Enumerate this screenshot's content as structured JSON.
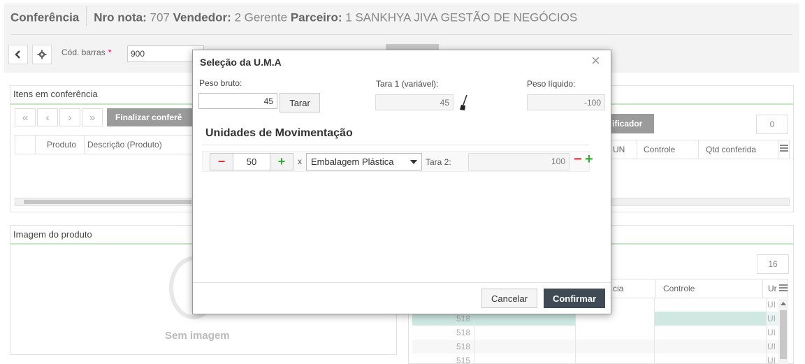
{
  "header": {
    "title": "Conferência",
    "nro_nota_label": "Nro nota:",
    "nro_nota_value": "707",
    "vendedor_label": "Vendedor:",
    "vendedor_value": "2 Gerente",
    "parceiro_label": "Parceiro:",
    "parceiro_value": "1 SANKHYA JIVA GESTÃO DE NEGÓCIOS"
  },
  "toolbar": {
    "back_icon": "chevron-left",
    "settings_icon": "gear",
    "cod_barras_label": "Cód. barras",
    "required_mark": "*",
    "cod_barras_value": "900"
  },
  "itens_panel": {
    "title": "Itens em conferência",
    "finalizar_label": "Finalizar conferê",
    "columns": [
      "Produto",
      "Descrição (Produto)"
    ]
  },
  "right_panel_top": {
    "verificador_label": "ificador",
    "count": "0",
    "columns": [
      "UN",
      "Controle",
      "Qtd conferida"
    ]
  },
  "imagem_panel": {
    "title": "Imagem do produto",
    "sem_imagem": "Sem imagem"
  },
  "right_panel_bottom": {
    "count": "16",
    "columns": [
      "cia",
      "Controle",
      "Ur"
    ],
    "rows": [
      {
        "num": "",
        "un": "UI"
      },
      {
        "num": "518",
        "un": "UI"
      },
      {
        "num": "518",
        "un": "UI"
      },
      {
        "num": "518",
        "un": "UI"
      },
      {
        "num": "515",
        "un": "UI"
      }
    ]
  },
  "modal": {
    "title": "Seleção da U.M.A",
    "close_icon": "close",
    "peso_bruto_label": "Peso bruto:",
    "peso_bruto_value": "45",
    "tarar_label": "Tarar",
    "tara1_label": "Tara 1 (variável):",
    "tara1_value": "45",
    "peso_liquido_label": "Peso líquido:",
    "peso_liquido_value": "-100",
    "section_title": "Unidades de Movimentação",
    "unit_row": {
      "minus": "−",
      "quantity": "50",
      "plus": "+",
      "times": "x",
      "embalagem": "Embalagem Plástica",
      "tara2_label": "Tara 2:",
      "tara2_value": "100",
      "remove": "−",
      "add": "+"
    },
    "cancel_label": "Cancelar",
    "confirm_label": "Confirmar"
  },
  "colors": {
    "accent_green": "#c7e4c5",
    "confirm_bg": "#3f4a55",
    "selected_row": "#cfe8e2"
  }
}
